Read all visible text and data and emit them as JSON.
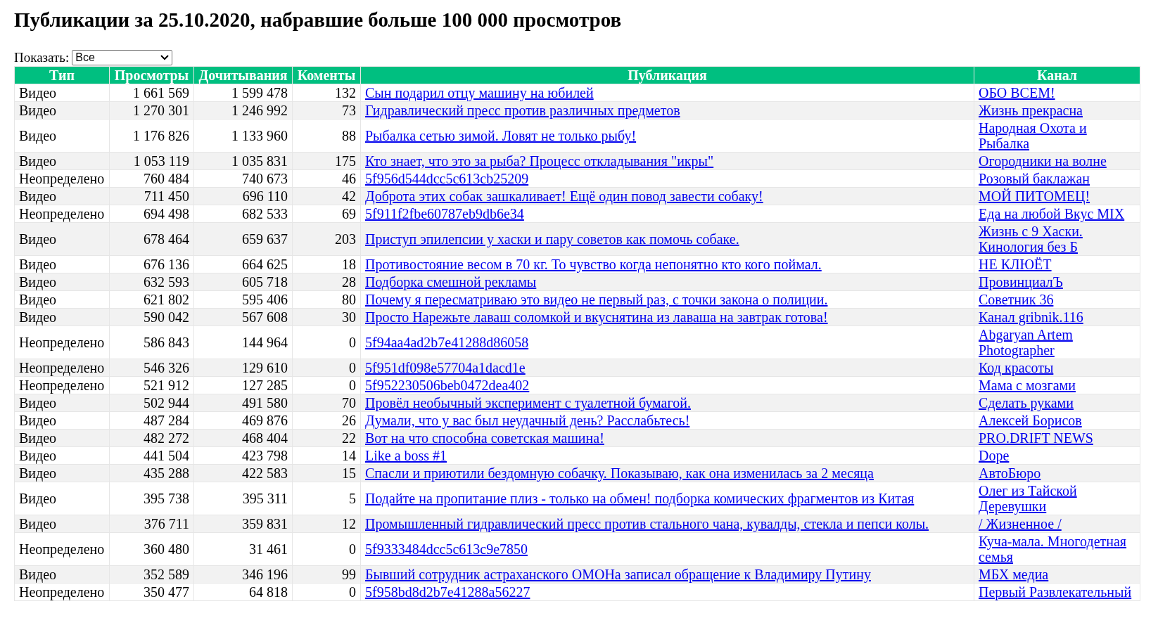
{
  "title": "Публикации за 25.10.2020, набравшие больше 100 000 просмотров",
  "filter": {
    "label": "Показать:",
    "value": "Все"
  },
  "table": {
    "columns": [
      "Тип",
      "Просмотры",
      "Дочитывания",
      "Коменты",
      "Публикация",
      "Канал"
    ],
    "rows": [
      {
        "type": "Видео",
        "views": "1 661 569",
        "reads": "1 599 478",
        "comments": "132",
        "publication": "Сын подарил отцу машину на юбилей",
        "channel": "ОБО ВСЕМ!"
      },
      {
        "type": "Видео",
        "views": "1 270 301",
        "reads": "1 246 992",
        "comments": "73",
        "publication": "Гидравлический пресс против различных предметов",
        "channel": "Жизнь прекрасна"
      },
      {
        "type": "Видео",
        "views": "1 176 826",
        "reads": "1 133 960",
        "comments": "88",
        "publication": "Рыбалка сетью зимой. Ловят не только рыбу!",
        "channel": "Народная Охота и Рыбалка"
      },
      {
        "type": "Видео",
        "views": "1 053 119",
        "reads": "1 035 831",
        "comments": "175",
        "publication": "Кто знает, что это за рыба? Процесс откладывания \"икры\"",
        "channel": "Огородники на волне"
      },
      {
        "type": "Неопределено",
        "views": "760 484",
        "reads": "740 673",
        "comments": "46",
        "publication": "5f956d544dcc5c613cb25209",
        "channel": "Розовый баклажан"
      },
      {
        "type": "Видео",
        "views": "711 450",
        "reads": "696 110",
        "comments": "42",
        "publication": "Доброта этих собак зашкаливает! Ещё один повод завести собаку!",
        "channel": "МОЙ ПИТОМЕЦ!"
      },
      {
        "type": "Неопределено",
        "views": "694 498",
        "reads": "682 533",
        "comments": "69",
        "publication": "5f911f2fbe60787eb9db6e34",
        "channel": "Еда на любой Вкус MIX"
      },
      {
        "type": "Видео",
        "views": "678 464",
        "reads": "659 637",
        "comments": "203",
        "publication": "Приступ эпилепсии у хаски и пару советов как помочь собаке.",
        "channel": "Жизнь с 9 Хаски. Кинология без Б"
      },
      {
        "type": "Видео",
        "views": "676 136",
        "reads": "664 625",
        "comments": "18",
        "publication": "Противостояние весом в 70 кг. То чувство когда непонятно кто кого поймал.",
        "channel": "НЕ КЛЮЁТ"
      },
      {
        "type": "Видео",
        "views": "632 593",
        "reads": "605 718",
        "comments": "28",
        "publication": "Подборка смешной рекламы",
        "channel": "ПровинциалЪ"
      },
      {
        "type": "Видео",
        "views": "621 802",
        "reads": "595 406",
        "comments": "80",
        "publication": "Почему я пересматриваю это видео не первый раз, с точки закона о полиции.",
        "channel": "Советник 36"
      },
      {
        "type": "Видео",
        "views": "590 042",
        "reads": "567 608",
        "comments": "30",
        "publication": "Просто Нарежьте лаваш соломкой и вкуснятина из лаваша на завтрак готова!",
        "channel": "Канал gribnik.116"
      },
      {
        "type": "Неопределено",
        "views": "586 843",
        "reads": "144 964",
        "comments": "0",
        "publication": "5f94aa4ad2b7e41288d86058",
        "channel": "Abgaryan Artem Photographer"
      },
      {
        "type": "Неопределено",
        "views": "546 326",
        "reads": "129 610",
        "comments": "0",
        "publication": "5f951df098e57704a1dacd1e",
        "channel": "Код красоты"
      },
      {
        "type": "Неопределено",
        "views": "521 912",
        "reads": "127 285",
        "comments": "0",
        "publication": "5f952230506beb0472dea402",
        "channel": "Мама с мозгами"
      },
      {
        "type": "Видео",
        "views": "502 944",
        "reads": "491 580",
        "comments": "70",
        "publication": "Провёл необычный эксперимент с туалетной бумагой.",
        "channel": "Сделать руками"
      },
      {
        "type": "Видео",
        "views": "487 284",
        "reads": "469 876",
        "comments": "26",
        "publication": "Думали, что у вас был неудачный день? Расслабьтесь!",
        "channel": "Алексей Борисов"
      },
      {
        "type": "Видео",
        "views": "482 272",
        "reads": "468 404",
        "comments": "22",
        "publication": "Вот на что способна советская машина!",
        "channel": "PRO.DRIFT NEWS"
      },
      {
        "type": "Видео",
        "views": "441 504",
        "reads": "423 798",
        "comments": "14",
        "publication": "Like a boss #1",
        "channel": "Dope"
      },
      {
        "type": "Видео",
        "views": "435 288",
        "reads": "422 583",
        "comments": "15",
        "publication": "Спасли и приютили бездомную собачку. Показываю, как она изменилась за 2 месяца",
        "channel": "АвтоБюро"
      },
      {
        "type": "Видео",
        "views": "395 738",
        "reads": "395 311",
        "comments": "5",
        "publication": "Подайте на пропитание плиз - только на обмен! подборка комических фрагментов из Китая",
        "channel": "Олег из Тайской Деревушки"
      },
      {
        "type": "Видео",
        "views": "376 711",
        "reads": "359 831",
        "comments": "12",
        "publication": "Промышленный гидравлический пресс против стального чана, кувалды, стекла и пепси колы.",
        "channel": "/ Жизненное /"
      },
      {
        "type": "Неопределено",
        "views": "360 480",
        "reads": "31 461",
        "comments": "0",
        "publication": "5f9333484dcc5c613c9e7850",
        "channel": "Куча-мала. Многодетная семья"
      },
      {
        "type": "Видео",
        "views": "352 589",
        "reads": "346 196",
        "comments": "99",
        "publication": "Бывший сотрудник астраханского ОМОНа записал обращение к Владимиру Путину",
        "channel": "МБХ медиа"
      },
      {
        "type": "Неопределено",
        "views": "350 477",
        "reads": "64 818",
        "comments": "0",
        "publication": "5f958bd8d2b7e41288a56227",
        "channel": "Первый Развлекательный"
      }
    ]
  }
}
